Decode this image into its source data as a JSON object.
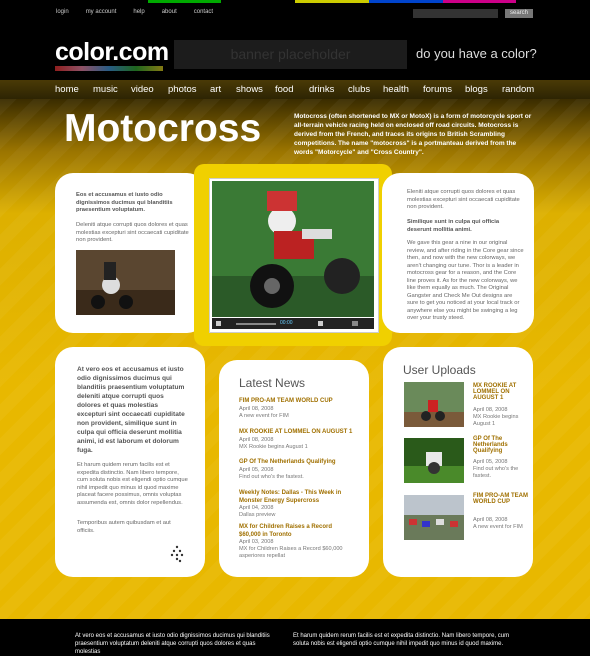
{
  "top_links": [
    "login",
    "my account",
    "help",
    "about",
    "contact"
  ],
  "search": {
    "button": "search"
  },
  "logo": "color.com",
  "banner": "banner placeholder",
  "tagline": "do you have a color?",
  "nav": [
    "home",
    "music",
    "video",
    "photos",
    "art",
    "shows",
    "food",
    "drinks",
    "clubs",
    "health",
    "forums",
    "blogs",
    "random"
  ],
  "title": "Motocross",
  "intro": "Motocross (often shortened to MX or MotoX) is a form of motorcycle sport or all-terrain vehicle racing held on enclosed off road circuits. Motocross is derived from the French, and traces its origins to British Scrambling competitions. The name \"motocross\" is a portmanteau derived from the words \"Motorcycle\" and \"Cross Country\".",
  "left_card": {
    "bold": "Eos et accusamus et iusto odio dignissimos ducimus qui blanditiis praesentium voluptatum.",
    "text": "Deleniti atque corrupti quos dolores et quas molestias excepturi sint occaecati cupiditate non provident."
  },
  "video": {
    "time": "00:00"
  },
  "right_card": {
    "p1": "Eleniti atque corrupti quos dolores et quas molestias excepturi sint occaecati cupiditate non provident.",
    "bold": "Similique sunt in culpa qui officia deserunt mollitia animi.",
    "p2": "We gave this gear a nine in our original review, and after riding in the Core gear since then, and now with the new colorways, we aren't changing our tune. Thor is a leader in motocross gear for a reason, and the Core line proves it. As for the new colorways, we like them equally as much. The Original Gangster and Check Me Out designs are sure to get you noticed at your local track or anywhere else you might be swinging a leg over your trusty steed."
  },
  "text_card": {
    "bold": "At vero eos et accusamus et iusto odio dignissimos ducimus qui blanditiis praesentium voluptatum deleniti atque corrupti quos dolores et quas molestias excepturi sint occaecati cupiditate non provident, similique sunt in culpa qui officia deserunt mollitia animi, id est laborum et dolorum fuga.",
    "p1": "Et harum quidem rerum facilis est et expedita distinctio. Nam libero tempore, cum soluta nobis est eligendi optio cumque nihil impedit quo minus id quod maxime placeat facere possimus, omnis voluptas assumenda est, omnis dolor repellendus.",
    "p2": "Temporibus autem quibusdam et aut officiis."
  },
  "news": {
    "heading": "Latest News",
    "items": [
      {
        "title": "FIM PRO-AM TEAM WORLD CUP",
        "date": "April 08, 2008",
        "desc": "A new event for FIM"
      },
      {
        "title": "MX ROOKIE AT LOMMEL ON AUGUST 1",
        "date": "April 08, 2008",
        "desc": "MX Rookie begins August 1"
      },
      {
        "title": "GP Of The Netherlands Qualifying",
        "date": "April 05, 2008",
        "desc": "Find out who's the fastest."
      },
      {
        "title": "Weekly Notes: Dallas - This Week in Monster Energy Supercross",
        "date": "April 04, 2008",
        "desc": "Dallas preview"
      },
      {
        "title": "MX for Children Raises a Record $60,000 in Toronto",
        "date": "April 03, 2008",
        "desc": "MX for Children Raises a Record $60,000 asperiores repellat"
      }
    ]
  },
  "uploads": {
    "heading": "User Uploads",
    "items": [
      {
        "title": "MX ROOKIE AT LOMMEL ON AUGUST 1",
        "date": "April 08, 2008",
        "desc": "MX Rookie begins August 1"
      },
      {
        "title": "GP Of The Netherlands Qualifying",
        "date": "April 05, 2008",
        "desc": "Find out who's the fastest."
      },
      {
        "title": "FIM PRO-AM TEAM WORLD CUP",
        "date": "April 08, 2008",
        "desc": "A new event for FIM"
      }
    ]
  },
  "footer": {
    "col1": "At vero eos et accusamus et iusto odio dignissimos ducimus qui blanditiis praesentium voluptatum deleniti atque corrupti quos dolores et quas molestias",
    "col2": "Et harum quidem rerum facilis est et expedita distinctio. Nam libero tempore, cum soluta nobis est eligendi optio cumque nihil impedit quo minus id quod maxime."
  },
  "colors": {
    "accent": "#e8b800",
    "news_title": "#a07000",
    "nav_bg": "#3a2e04"
  }
}
